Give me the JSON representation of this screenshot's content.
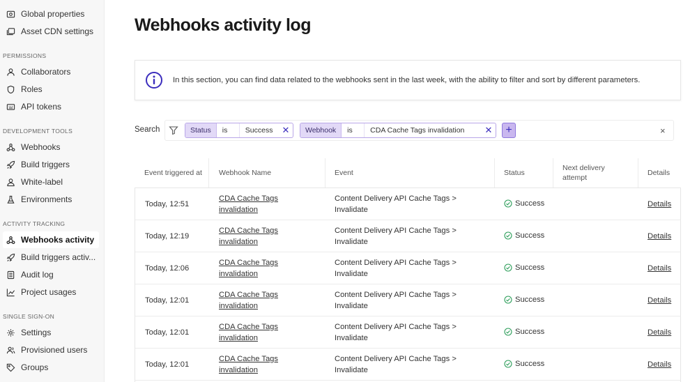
{
  "sidebar": {
    "items_top": [
      {
        "label": "Global properties",
        "icon": "folder-gear-icon"
      },
      {
        "label": "Asset CDN settings",
        "icon": "images-icon"
      }
    ],
    "sections": [
      {
        "title": "PERMISSIONS",
        "items": [
          {
            "label": "Collaborators",
            "icon": "user-icon"
          },
          {
            "label": "Roles",
            "icon": "shield-icon"
          },
          {
            "label": "API tokens",
            "icon": "keypad-icon"
          }
        ]
      },
      {
        "title": "DEVELOPMENT TOOLS",
        "items": [
          {
            "label": "Webhooks",
            "icon": "webhook-icon"
          },
          {
            "label": "Build triggers",
            "icon": "rocket-icon"
          },
          {
            "label": "White-label",
            "icon": "user-tag-icon"
          },
          {
            "label": "Environments",
            "icon": "flask-icon"
          }
        ]
      },
      {
        "title": "ACTIVITY TRACKING",
        "items": [
          {
            "label": "Webhooks activity",
            "icon": "webhook-icon",
            "active": true
          },
          {
            "label": "Build triggers activ...",
            "icon": "rocket-icon"
          },
          {
            "label": "Audit log",
            "icon": "list-icon"
          },
          {
            "label": "Project usages",
            "icon": "chart-icon"
          }
        ]
      },
      {
        "title": "SINGLE SIGN-ON",
        "items": [
          {
            "label": "Settings",
            "icon": "gear-icon"
          },
          {
            "label": "Provisioned users",
            "icon": "users-icon"
          },
          {
            "label": "Groups",
            "icon": "tag-icon"
          }
        ]
      }
    ]
  },
  "main": {
    "title": "Webhooks activity log",
    "info_text": "In this section, you can find data related to the webhooks sent in the last week, with the ability to filter and sort by different parameters.",
    "search_label": "Search",
    "filters": [
      {
        "key": "Status",
        "op": "is",
        "value": "Success"
      },
      {
        "key": "Webhook",
        "op": "is",
        "value": "CDA Cache Tags invalidation"
      }
    ],
    "add_filter": "+",
    "clear": "×",
    "accent": "#3b2dbd"
  },
  "table": {
    "headers": {
      "event_triggered": "Event triggered at",
      "webhook_name": "Webhook Name",
      "event": "Event",
      "status": "Status",
      "next_delivery": "Next delivery attempt",
      "details": "Details"
    },
    "rows": [
      {
        "time": "Today, 12:51",
        "name_line1": "CDA Cache Tags",
        "name_line2": "invalidation",
        "event_line1": "Content Delivery API Cache Tags >",
        "event_line2": "Invalidate",
        "status": "Success",
        "details": "Details"
      },
      {
        "time": "Today, 12:19",
        "name_line1": "CDA Cache Tags",
        "name_line2": "invalidation",
        "event_line1": "Content Delivery API Cache Tags >",
        "event_line2": "Invalidate",
        "status": "Success",
        "details": "Details"
      },
      {
        "time": "Today, 12:06",
        "name_line1": "CDA Cache Tags",
        "name_line2": "invalidation",
        "event_line1": "Content Delivery API Cache Tags >",
        "event_line2": "Invalidate",
        "status": "Success",
        "details": "Details"
      },
      {
        "time": "Today, 12:01",
        "name_line1": "CDA Cache Tags",
        "name_line2": "invalidation",
        "event_line1": "Content Delivery API Cache Tags >",
        "event_line2": "Invalidate",
        "status": "Success",
        "details": "Details"
      },
      {
        "time": "Today, 12:01",
        "name_line1": "CDA Cache Tags",
        "name_line2": "invalidation",
        "event_line1": "Content Delivery API Cache Tags >",
        "event_line2": "Invalidate",
        "status": "Success",
        "details": "Details"
      },
      {
        "time": "Today, 12:01",
        "name_line1": "CDA Cache Tags",
        "name_line2": "invalidation",
        "event_line1": "Content Delivery API Cache Tags >",
        "event_line2": "Invalidate",
        "status": "Success",
        "details": "Details"
      }
    ],
    "success_color": "#2e9e5b"
  }
}
